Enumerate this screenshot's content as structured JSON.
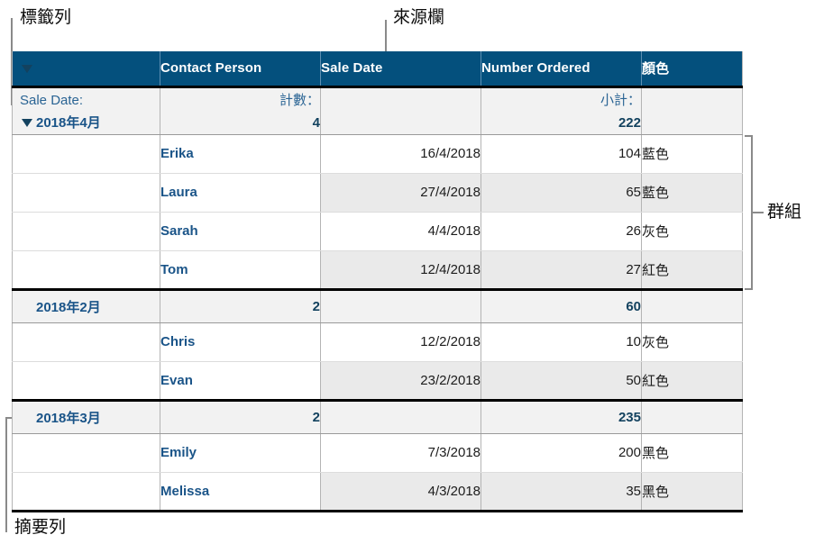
{
  "annotations": [
    {
      "id": "label-row",
      "text": "標籤列"
    },
    {
      "id": "source-column",
      "text": "來源欄"
    },
    {
      "id": "group",
      "text": "群組"
    },
    {
      "id": "summary-row",
      "text": "摘要列"
    }
  ],
  "table": {
    "columns": [
      "",
      "Contact Person",
      "Sale Date",
      "Number Ordered",
      "顏色"
    ],
    "summary_labels": {
      "category": "Sale Date:",
      "count": "計數：",
      "subtotal": "小計：",
      "blank": ""
    },
    "groups": [
      {
        "name": "2018年4月",
        "disclosure": "▼",
        "count": "4",
        "subtotal": "222",
        "rows": [
          {
            "person": "Erika",
            "date": "16/4/2018",
            "number": "104",
            "color": "藍色"
          },
          {
            "person": "Laura",
            "date": "27/4/2018",
            "number": "65",
            "color": "藍色"
          },
          {
            "person": "Sarah",
            "date": "4/4/2018",
            "number": "26",
            "color": "灰色"
          },
          {
            "person": "Tom",
            "date": "12/4/2018",
            "number": "27",
            "color": "紅色"
          }
        ]
      },
      {
        "name": "2018年2月",
        "disclosure": "▼",
        "count": "2",
        "subtotal": "60",
        "rows": [
          {
            "person": "Chris",
            "date": "12/2/2018",
            "number": "10",
            "color": "灰色"
          },
          {
            "person": "Evan",
            "date": "23/2/2018",
            "number": "50",
            "color": "紅色"
          }
        ]
      },
      {
        "name": "2018年3月",
        "disclosure": "▼",
        "count": "2",
        "subtotal": "235",
        "rows": [
          {
            "person": "Emily",
            "date": "7/3/2018",
            "number": "200",
            "color": "黑色"
          },
          {
            "person": "Melissa",
            "date": "4/3/2018",
            "number": "35",
            "color": "黑色"
          }
        ]
      }
    ]
  },
  "colors": {
    "header_background": "#04507d",
    "header_text": "#ffffff",
    "accent_text": "#1a5488",
    "summary_background": "#f2f2f2",
    "alt_row_background": "#eaeaea",
    "leader_line": "#8a8a8a"
  }
}
